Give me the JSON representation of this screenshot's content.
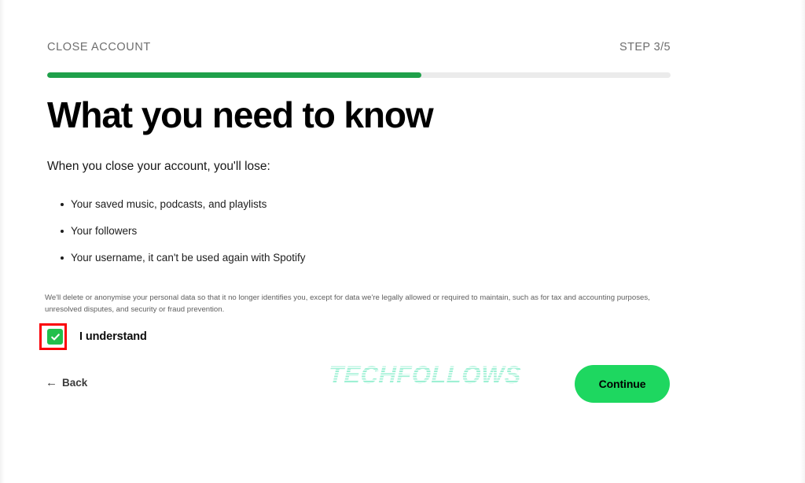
{
  "header": {
    "eyebrow": "CLOSE ACCOUNT",
    "step": "STEP 3/5"
  },
  "progress": {
    "percent": 60,
    "fill_color": "#1fa04a",
    "track_color": "#ebebeb"
  },
  "main": {
    "title": "What you need to know",
    "intro": "When you close your account, you'll lose:",
    "losses": [
      "Your saved music, podcasts, and playlists",
      "Your followers",
      "Your username, it can't be used again with Spotify"
    ],
    "fine_print": "We'll delete or anonymise your personal data so that it no longer identifies you, except for data we're legally allowed or required to maintain, such as for tax and accounting purposes, unresolved disputes, and security or fraud prevention."
  },
  "consent": {
    "label": "I understand",
    "checked": true,
    "checkbox_color": "#22bf4c",
    "highlight_color": "#fb0007"
  },
  "footer": {
    "back_label": "Back",
    "back_arrow": "←",
    "continue_label": "Continue",
    "continue_color": "#1ed760"
  },
  "watermark": {
    "text": "TECHFOLLOWS",
    "color": "#9ef0d4"
  }
}
